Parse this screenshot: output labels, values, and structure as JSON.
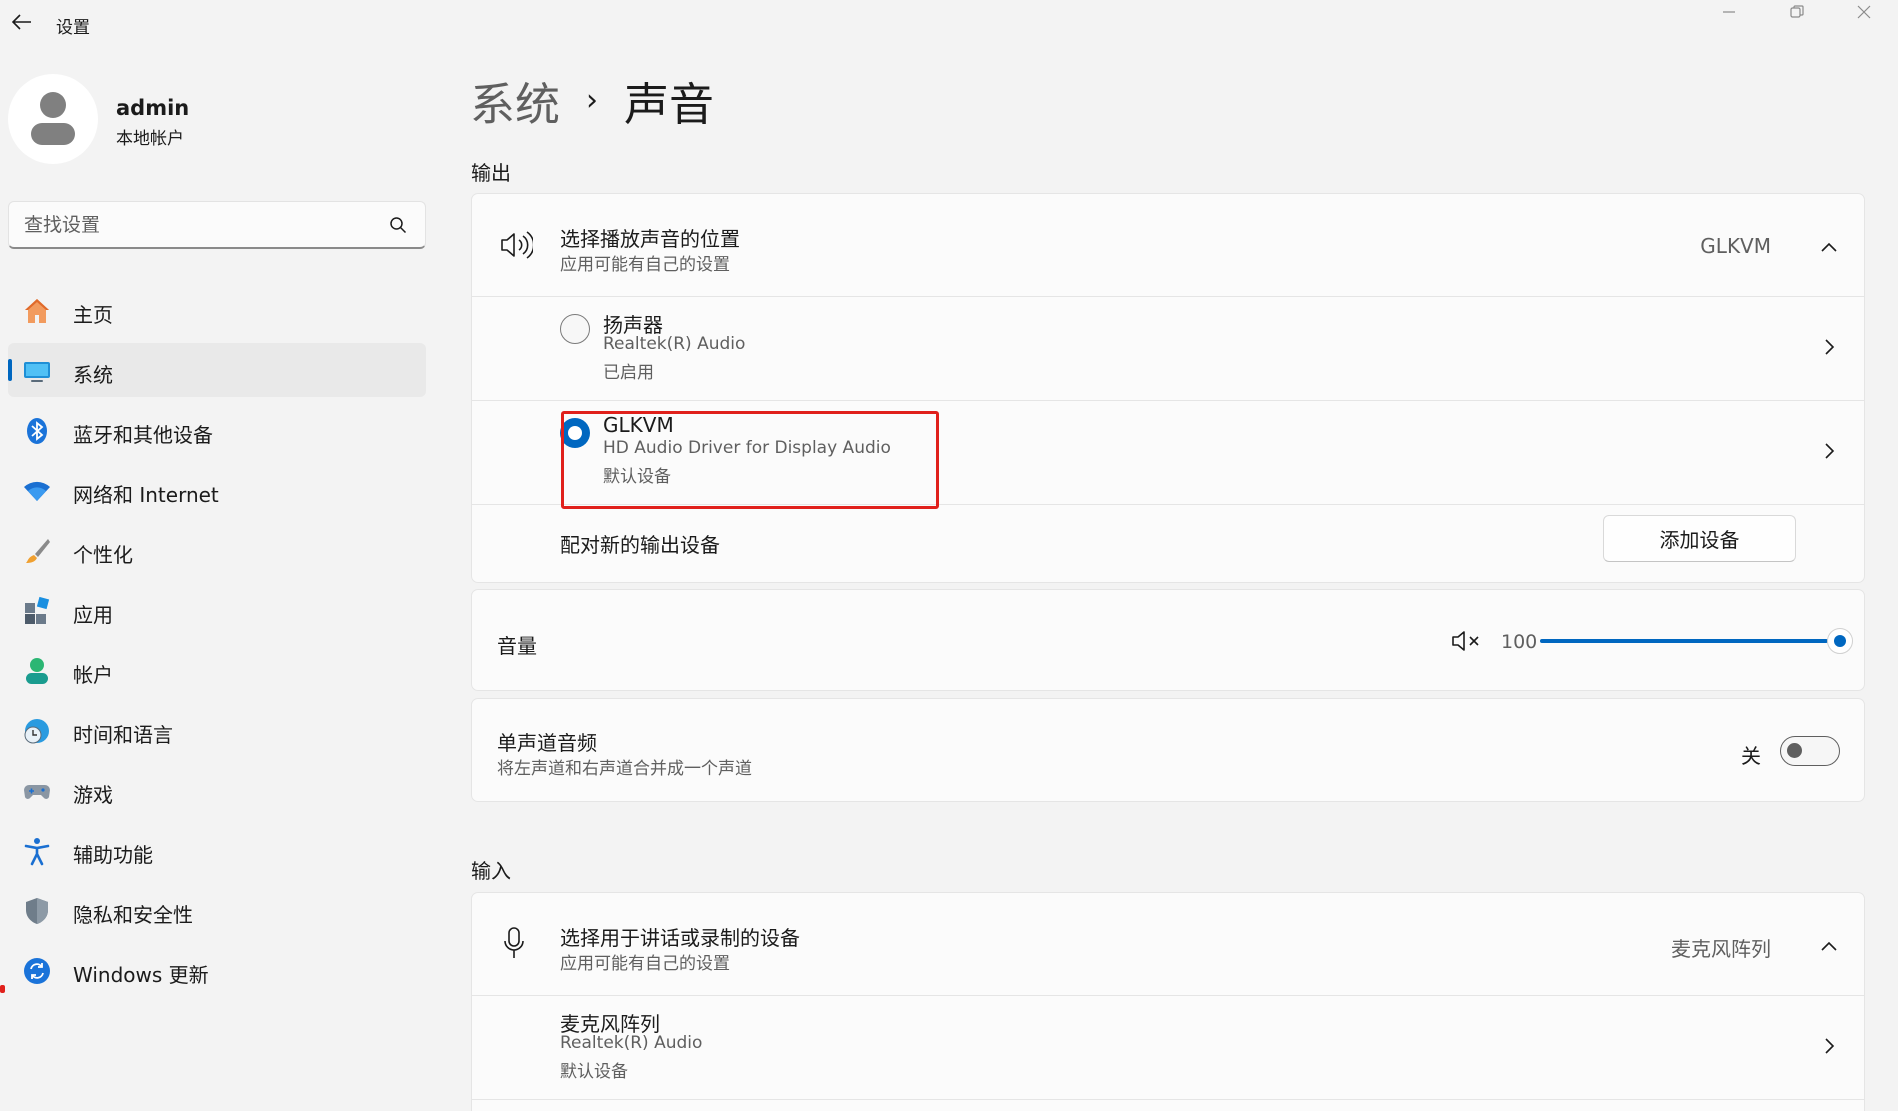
{
  "app": {
    "title": "设置"
  },
  "window_controls": {
    "minimize_icon": "minimize-icon",
    "maximize_icon": "restore-icon",
    "close_icon": "close-icon"
  },
  "profile": {
    "name": "admin",
    "account_type": "本地帐户"
  },
  "search": {
    "placeholder": "查找设置",
    "value": ""
  },
  "sidebar": {
    "items": [
      {
        "label": "主页",
        "icon": "home-icon",
        "active": false
      },
      {
        "label": "系统",
        "icon": "system-display-icon",
        "active": true
      },
      {
        "label": "蓝牙和其他设备",
        "icon": "bluetooth-icon",
        "active": false
      },
      {
        "label": "网络和 Internet",
        "icon": "wifi-icon",
        "active": false
      },
      {
        "label": "个性化",
        "icon": "brush-icon",
        "active": false
      },
      {
        "label": "应用",
        "icon": "apps-icon",
        "active": false
      },
      {
        "label": "帐户",
        "icon": "account-icon",
        "active": false
      },
      {
        "label": "时间和语言",
        "icon": "time-language-icon",
        "active": false
      },
      {
        "label": "游戏",
        "icon": "gamepad-icon",
        "active": false
      },
      {
        "label": "辅助功能",
        "icon": "accessibility-icon",
        "active": false
      },
      {
        "label": "隐私和安全性",
        "icon": "shield-icon",
        "active": false
      },
      {
        "label": "Windows 更新",
        "icon": "update-icon",
        "active": false
      }
    ]
  },
  "breadcrumb": {
    "parent": "系统",
    "separator": "›",
    "current": "声音"
  },
  "output": {
    "section_title": "输出",
    "device_picker": {
      "title": "选择播放声音的位置",
      "subtitle": "应用可能有自己的设置",
      "selected": "GLKVM"
    },
    "devices": [
      {
        "name": "扬声器",
        "driver": "Realtek(R) Audio",
        "status": "已启用",
        "selected": false
      },
      {
        "name": "GLKVM",
        "driver": "HD Audio Driver for Display Audio",
        "status": "默认设备",
        "selected": true
      }
    ],
    "pair": {
      "label": "配对新的输出设备",
      "button": "添加设备"
    },
    "volume": {
      "label": "音量",
      "value": "100",
      "level_percent": 100
    },
    "mono": {
      "title": "单声道音频",
      "subtitle": "将左声道和右声道合并成一个声道",
      "state": "关"
    }
  },
  "input": {
    "section_title": "输入",
    "device_picker": {
      "title": "选择用于讲话或录制的设备",
      "subtitle": "应用可能有自己的设置",
      "selected": "麦克风阵列"
    },
    "devices": [
      {
        "name": "麦克风阵列",
        "driver": "Realtek(R) Audio",
        "status": "默认设备"
      }
    ]
  },
  "colors": {
    "accent": "#0067c0",
    "highlight_box": "#e0201b",
    "background": "#f3f3f3",
    "card": "#fbfbfb"
  }
}
